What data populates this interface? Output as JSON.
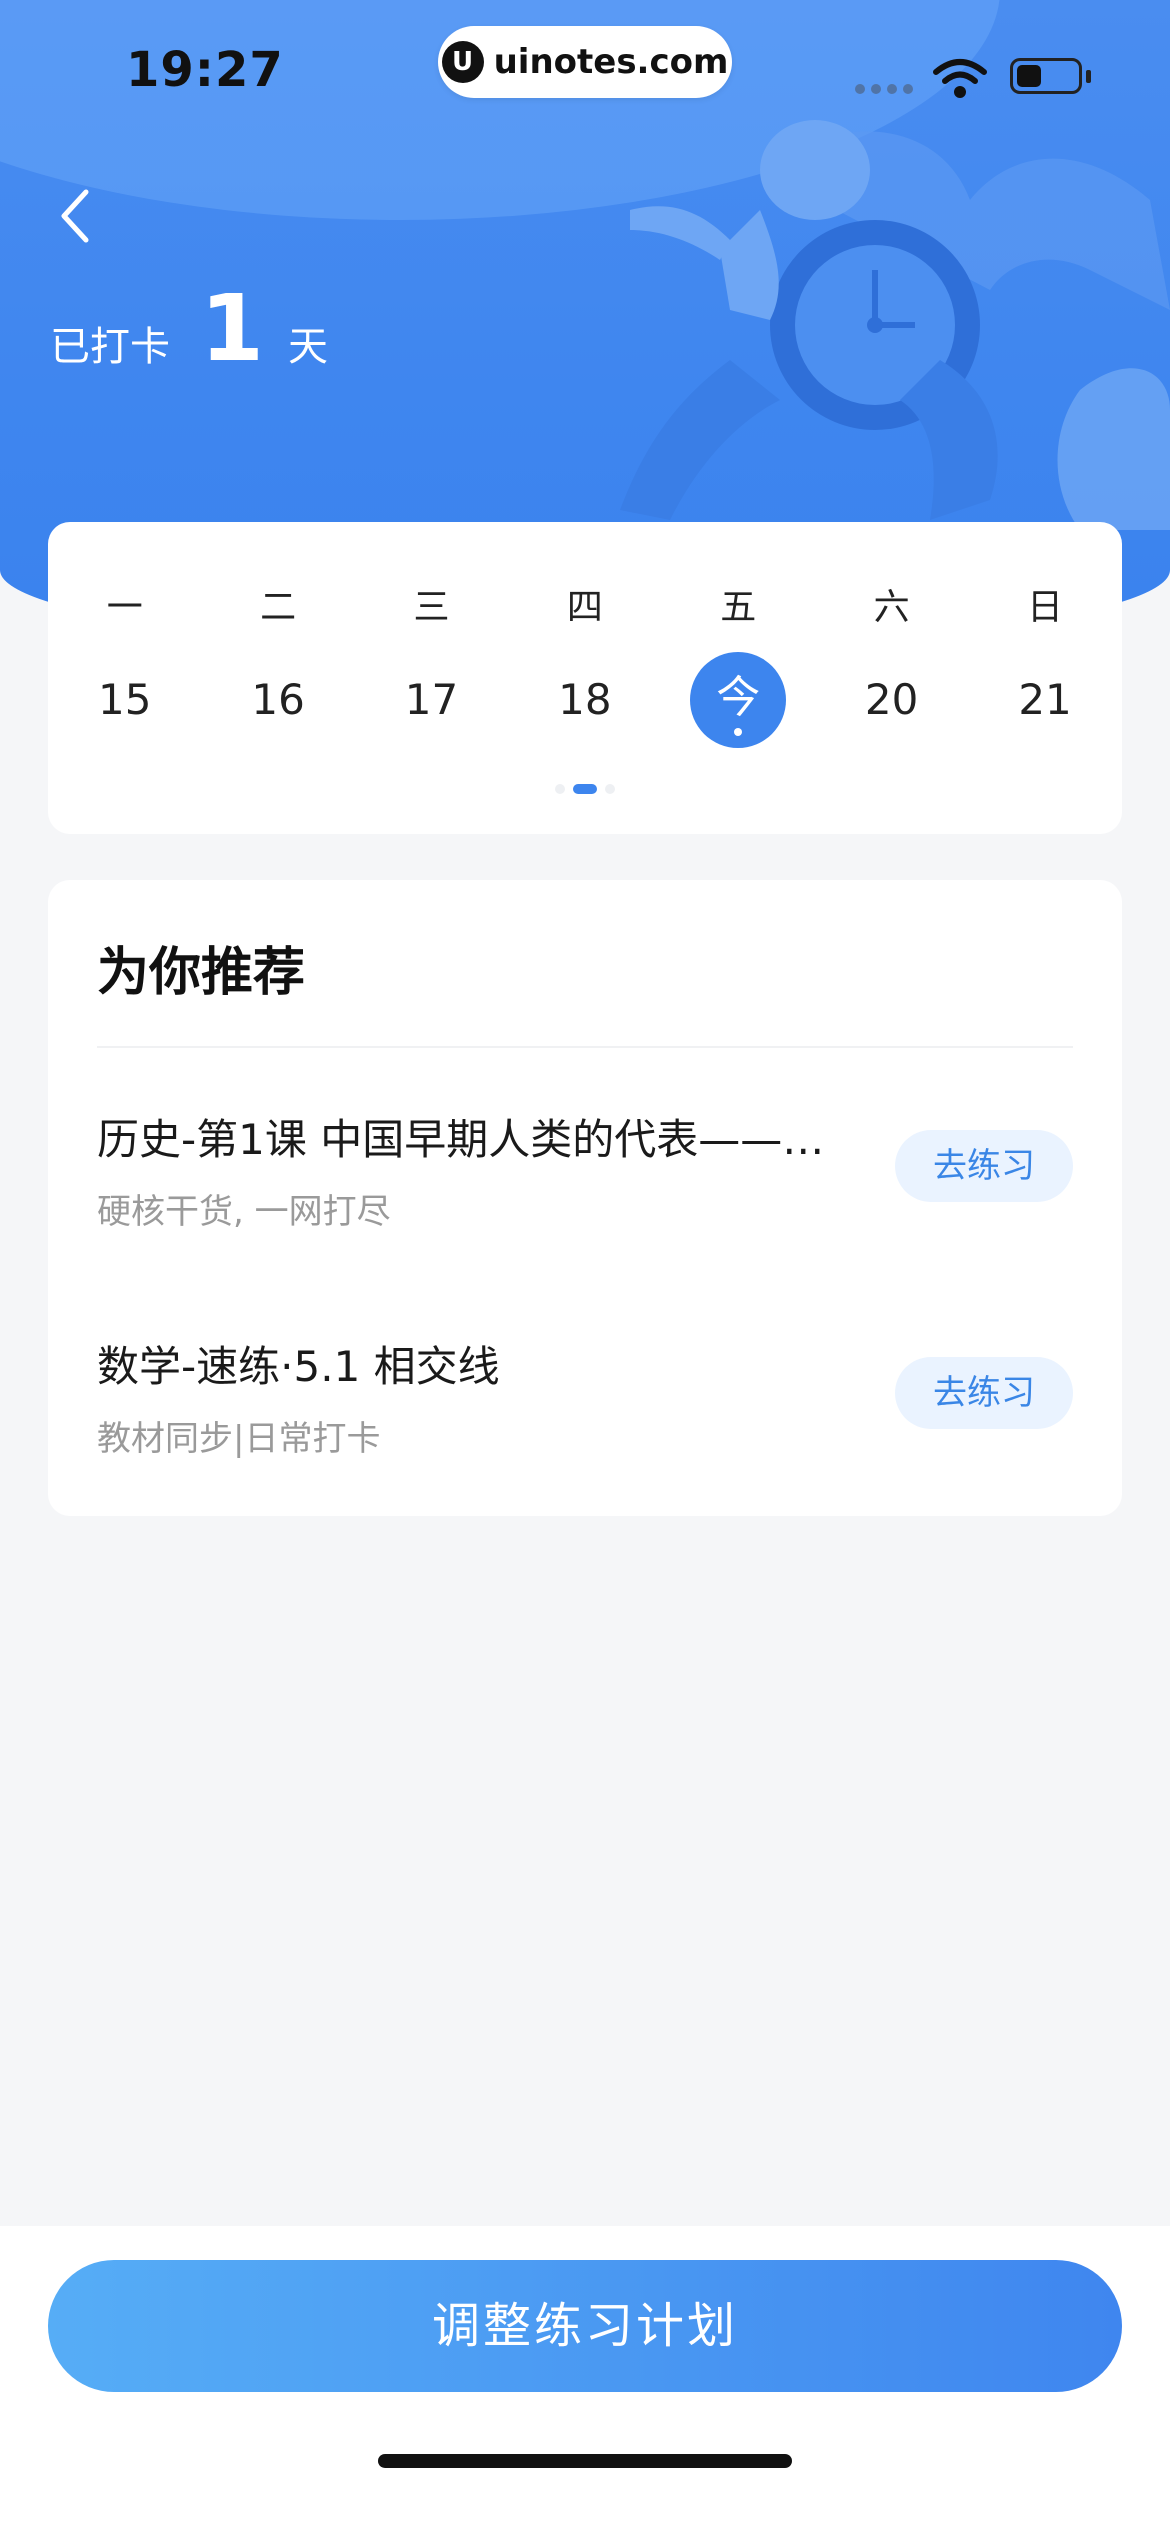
{
  "status_bar": {
    "time": "19:27",
    "url": "uinotes.com",
    "logo_letter": "U"
  },
  "header": {
    "checkin_label": "已打卡",
    "checkin_days": "1",
    "checkin_unit": "天"
  },
  "week": {
    "weekdays": [
      "一",
      "二",
      "三",
      "四",
      "五",
      "六",
      "日"
    ],
    "dates": [
      "15",
      "16",
      "17",
      "18",
      "今",
      "20",
      "21"
    ],
    "today_index": 4
  },
  "recommend": {
    "title": "为你推荐",
    "items": [
      {
        "title": "历史-第1课 中国早期人类的代表——…",
        "subtitle": "硬核干货, 一网打尽",
        "button": "去练习"
      },
      {
        "title": "数学-速练·5.1 相交线",
        "subtitle": "教材同步|日常打卡",
        "button": "去练习"
      }
    ]
  },
  "footer": {
    "button": "调整练习计划"
  },
  "colors": {
    "accent": "#3d85ee",
    "hero": "#4a8df0",
    "chip_bg": "#eaf3ff",
    "chip_text": "#3a86e6"
  }
}
